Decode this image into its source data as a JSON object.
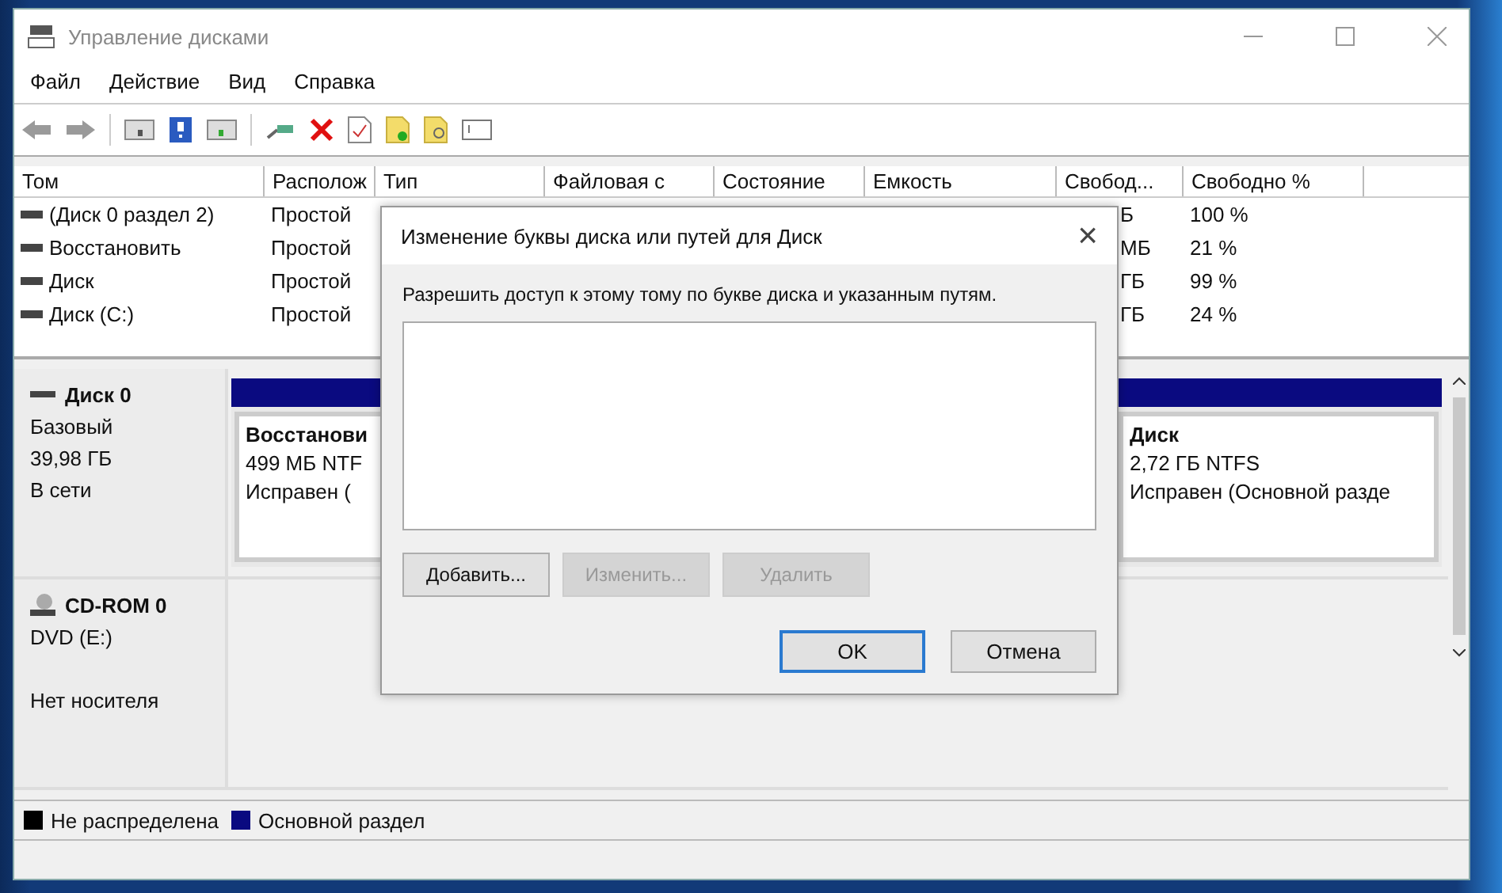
{
  "window": {
    "title": "Управление дисками"
  },
  "menu": [
    "Файл",
    "Действие",
    "Вид",
    "Справка"
  ],
  "volume_table": {
    "columns": [
      "Том",
      "Располож",
      "Тип",
      "Файловая с",
      "Состояние",
      "Емкость",
      "Свобод...",
      "Свободно %"
    ],
    "rows": [
      {
        "name": "(Диск 0 раздел 2)",
        "layout": "Простой",
        "free_tail": "Б",
        "free_pct": "100 %"
      },
      {
        "name": "Восстановить",
        "layout": "Простой",
        "free_tail": "МБ",
        "free_pct": "21 %"
      },
      {
        "name": "Диск",
        "layout": "Простой",
        "free_tail": "ГБ",
        "free_pct": "99 %"
      },
      {
        "name": "Диск (C:)",
        "layout": "Простой",
        "free_tail": "ГБ",
        "free_pct": "24 %"
      }
    ]
  },
  "disks": [
    {
      "kind": "disk",
      "name": "Диск 0",
      "type": "Базовый",
      "size": "39,98 ГБ",
      "status": "В сети",
      "partitions": [
        {
          "name": "Восстанови",
          "detail": "499 МБ NTF",
          "health": "Исправен ("
        },
        {
          "name": "Диск",
          "detail": "2,72 ГБ NTFS",
          "health": "Исправен (Основной разде"
        }
      ]
    },
    {
      "kind": "cdrom",
      "name": "CD-ROM 0",
      "type": "DVD (E:)",
      "status": "Нет носителя"
    }
  ],
  "legend": [
    {
      "label": "Не распределена",
      "color": "#000000"
    },
    {
      "label": "Основной раздел",
      "color": "#0a0a80"
    }
  ],
  "dialog": {
    "title": "Изменение буквы диска или путей для Диск",
    "close": "×",
    "prompt": "Разрешить доступ к этому тому по букве диска и указанным путям.",
    "actions": [
      {
        "label": "Добавить...",
        "disabled": false
      },
      {
        "label": "Изменить...",
        "disabled": true
      },
      {
        "label": "Удалить",
        "disabled": true
      }
    ],
    "buttons": [
      {
        "label": "OK",
        "default": true
      },
      {
        "label": "Отмена",
        "default": false
      }
    ]
  }
}
